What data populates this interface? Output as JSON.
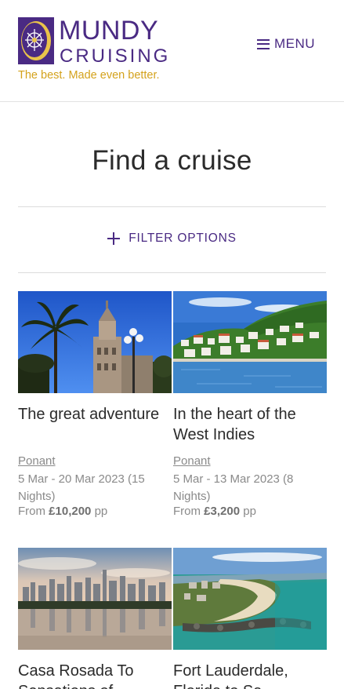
{
  "header": {
    "logo_word1": "MUNDY",
    "logo_word2": "CRUISING",
    "tagline": "The best. Made even better.",
    "menu_label": "MENU"
  },
  "page": {
    "title": "Find a cruise",
    "filter_label": "FILTER OPTIONS"
  },
  "colors": {
    "brand_purple": "#4a2a83",
    "brand_gold": "#d4a21c",
    "muted_text": "#8a8a8a"
  },
  "cruises": [
    {
      "title": "The great adventure",
      "operator": "Ponant",
      "dates": "5 Mar - 20 Mar 2023 (15 Nights)",
      "price_prefix": "From ",
      "price": "£10,200",
      "price_suffix": " pp",
      "image": "palm-trees-cathedral"
    },
    {
      "title": "In the heart of the West Indies",
      "operator": "Ponant",
      "dates": "5 Mar - 13 Mar 2023 (8 Nights)",
      "price_prefix": "From ",
      "price": "£3,200",
      "price_suffix": " pp",
      "image": "caribbean-harbour-town"
    },
    {
      "title": "Casa Rosada To Sensations of...",
      "image": "city-skyline-lake"
    },
    {
      "title": "Fort Lauderdale, Florida to Sa...",
      "image": "beach-coastline-aerial"
    }
  ]
}
